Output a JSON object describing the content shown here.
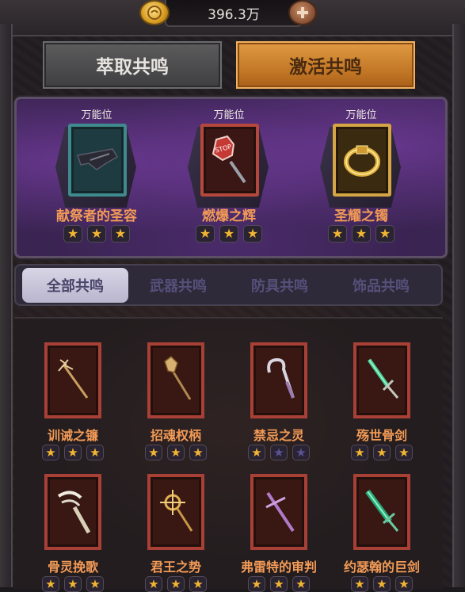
{
  "currency": {
    "value": "396.3万",
    "coin_icon": "gold-coin-icon",
    "add_icon": "plus-icon"
  },
  "tabs": {
    "extract": "萃取共鸣",
    "activate": "激活共鸣",
    "active": "activate"
  },
  "featured": [
    {
      "tag": "万能位",
      "name": "献祭者的圣容",
      "frame": "teal",
      "icon": "dark-mask-icon",
      "stars": 3
    },
    {
      "tag": "万能位",
      "name": "燃爆之辉",
      "frame": "red",
      "icon": "stop-sign-icon",
      "stars": 3
    },
    {
      "tag": "万能位",
      "name": "圣耀之镯",
      "frame": "gold",
      "icon": "gold-ring-icon",
      "stars": 3
    }
  ],
  "subtabs": [
    "全部共鸣",
    "武器共鸣",
    "防具共鸣",
    "饰品共鸣"
  ],
  "items": [
    {
      "name": "训诫之镰",
      "icon": "trident-icon",
      "stars": 3
    },
    {
      "name": "招魂权柄",
      "icon": "claw-scepter-icon",
      "stars": 3
    },
    {
      "name": "禁忌之灵",
      "icon": "crook-staff-icon",
      "stars": 1
    },
    {
      "name": "殇世骨剑",
      "icon": "green-bone-sword-icon",
      "stars": 3
    },
    {
      "name": "骨灵挽歌",
      "icon": "bone-scythe-icon",
      "stars": 3
    },
    {
      "name": "君王之势",
      "icon": "sun-scepter-icon",
      "stars": 3
    },
    {
      "name": "弗雷特的审判",
      "icon": "cross-spear-icon",
      "stars": 3
    },
    {
      "name": "约瑟翰的巨剑",
      "icon": "green-greatsword-icon",
      "stars": 3
    }
  ],
  "colors": {
    "accent_orange": "#e09a42",
    "name_text": "#f29a56",
    "star_on": "#f2b531",
    "star_off": "#5b5296"
  }
}
